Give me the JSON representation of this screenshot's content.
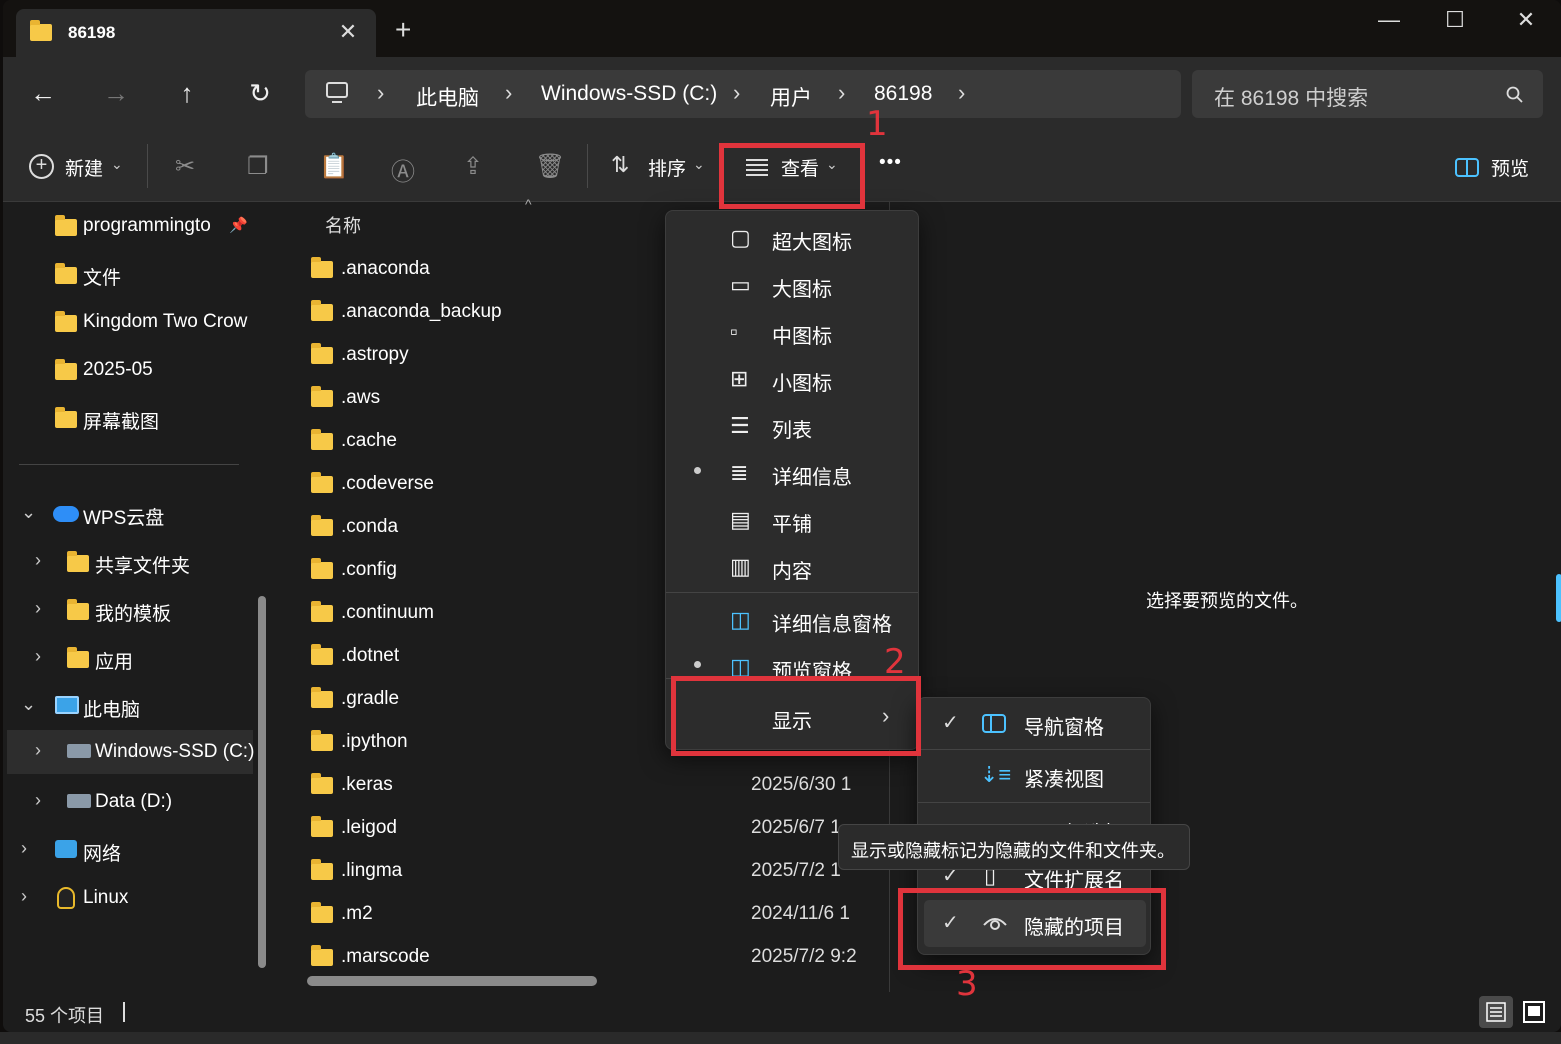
{
  "window": {
    "tab_title": "86198",
    "tab_close": "✕",
    "new_tab": "+",
    "minimize": "—",
    "maximize": "☐",
    "close": "✕"
  },
  "nav_buttons": {
    "back": "←",
    "forward": "→",
    "up": "↑",
    "refresh": "↻"
  },
  "breadcrumb": [
    "此电脑",
    "Windows-SSD (C:)",
    "用户",
    "86198"
  ],
  "search": {
    "placeholder": "在 86198 中搜索"
  },
  "toolbar": {
    "new_label": "新建",
    "sort_label": "排序",
    "view_label": "查看",
    "more_label": "•••",
    "preview_label": "预览"
  },
  "nav_pane": {
    "items": [
      {
        "label": "programmingto",
        "icon": "folder-icon"
      },
      {
        "label": "文件",
        "icon": "folder-icon"
      },
      {
        "label": "Kingdom Two Crow",
        "icon": "folder-icon"
      },
      {
        "label": "2025-05",
        "icon": "folder-icon"
      },
      {
        "label": "屏幕截图",
        "icon": "folder-icon"
      },
      {
        "label": "WPS云盘",
        "icon": "cloud-icon"
      },
      {
        "label": "共享文件夹",
        "icon": "shared-folder-icon"
      },
      {
        "label": "我的模板",
        "icon": "folder-icon"
      },
      {
        "label": "应用",
        "icon": "folder-icon"
      },
      {
        "label": "此电脑",
        "icon": "pc-icon"
      },
      {
        "label": "Windows-SSD (C:)",
        "icon": "drive-icon"
      },
      {
        "label": "Data (D:)",
        "icon": "drive-icon"
      },
      {
        "label": "网络",
        "icon": "network-icon"
      },
      {
        "label": "Linux",
        "icon": "linux-icon"
      }
    ]
  },
  "file_list": {
    "column_name": "名称",
    "rows": [
      {
        "name": ".anaconda",
        "date": ""
      },
      {
        "name": ".anaconda_backup",
        "date": ""
      },
      {
        "name": ".astropy",
        "date": ""
      },
      {
        "name": ".aws",
        "date": ""
      },
      {
        "name": ".cache",
        "date": ""
      },
      {
        "name": ".codeverse",
        "date": ""
      },
      {
        "name": ".conda",
        "date": ""
      },
      {
        "name": ".config",
        "date": ""
      },
      {
        "name": ".continuum",
        "date": ""
      },
      {
        "name": ".dotnet",
        "date": ""
      },
      {
        "name": ".gradle",
        "date": ""
      },
      {
        "name": ".ipython",
        "date": ""
      },
      {
        "name": ".keras",
        "date": "2025/6/30 1"
      },
      {
        "name": ".leigod",
        "date": "2025/6/7 1"
      },
      {
        "name": ".lingma",
        "date": "2025/7/2 1"
      },
      {
        "name": ".m2",
        "date": "2024/11/6 1"
      },
      {
        "name": ".marscode",
        "date": "2025/7/2 9:2"
      }
    ]
  },
  "view_menu": {
    "items": [
      {
        "label": "超大图标",
        "icon": "extra-large-icons-icon",
        "selected": false
      },
      {
        "label": "大图标",
        "icon": "large-icons-icon",
        "selected": false
      },
      {
        "label": "中图标",
        "icon": "medium-icons-icon",
        "selected": false
      },
      {
        "label": "小图标",
        "icon": "small-icons-icon",
        "selected": false
      },
      {
        "label": "列表",
        "icon": "list-icon",
        "selected": false
      },
      {
        "label": "详细信息",
        "icon": "details-icon",
        "selected": true
      },
      {
        "label": "平铺",
        "icon": "tiles-icon",
        "selected": false
      },
      {
        "label": "内容",
        "icon": "content-icon",
        "selected": false
      },
      {
        "label": "详细信息窗格",
        "icon": "details-pane-icon",
        "selected": false
      },
      {
        "label": "预览窗格",
        "icon": "preview-pane-icon",
        "selected": true
      }
    ],
    "show_label": "显示"
  },
  "show_submenu": {
    "items": [
      {
        "label": "导航窗格",
        "checked": true
      },
      {
        "label": "紧凑视图",
        "checked": false
      },
      {
        "label": "项目复选框",
        "checked": false
      },
      {
        "label": "文件扩展名",
        "checked": true
      },
      {
        "label": "隐藏的项目",
        "checked": true
      }
    ]
  },
  "tooltip": "显示或隐藏标记为隐藏的文件和文件夹。",
  "preview_pane": {
    "message": "选择要预览的文件。"
  },
  "status": {
    "item_count": "55 个项目"
  },
  "annotations": [
    "1",
    "2",
    "3"
  ],
  "colors": {
    "annotation_red": "#e0343c",
    "folder_yellow": "#f7c948",
    "accent_blue": "#4cc2ff"
  }
}
